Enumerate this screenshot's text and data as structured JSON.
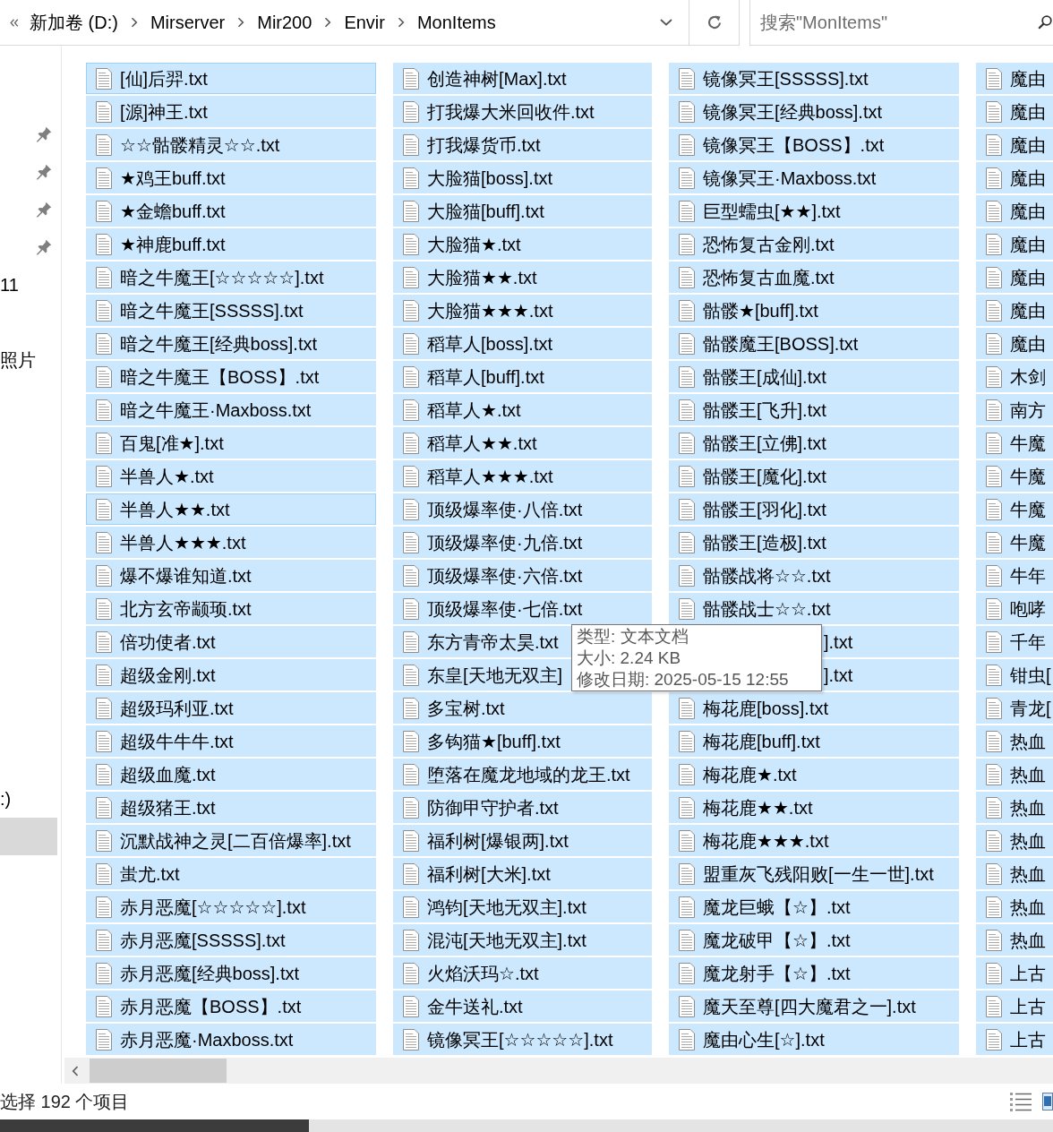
{
  "address_bar": {
    "path": [
      "新加卷 (D:)",
      "Mirserver",
      "Mir200",
      "Envir",
      "MonItems"
    ]
  },
  "search": {
    "placeholder": "搜索\"MonItems\""
  },
  "nav_pane": {
    "groups": [
      [
        {
          "pinned": true,
          "selected": false
        },
        {
          "pinned": true,
          "selected": false
        },
        {
          "pinned": true,
          "selected": false
        },
        {
          "pinned": true,
          "selected": false
        },
        {
          "label": "11",
          "pinned": false,
          "selected": false
        }
      ],
      [
        {
          "label": "照片",
          "pinned": false,
          "selected": false
        }
      ],
      [
        {
          "label": ":)",
          "pinned": false,
          "selected": false
        },
        {
          "pinned": false,
          "selected": true
        }
      ]
    ]
  },
  "file_list": {
    "columns": [
      {
        "items": [
          {
            "name": "[仙]后羿.txt",
            "kind": "file",
            "selected": true,
            "highlighted": true
          },
          {
            "name": "[源]神王.txt",
            "kind": "file",
            "selected": true,
            "highlighted": false
          },
          {
            "name": "☆☆骷髅精灵☆☆.txt",
            "kind": "file",
            "selected": true,
            "highlighted": false
          },
          {
            "name": "★鸡王buff.txt",
            "kind": "file",
            "selected": true,
            "highlighted": false
          },
          {
            "name": "★金蟾buff.txt",
            "kind": "file",
            "selected": true,
            "highlighted": false
          },
          {
            "name": "★神鹿buff.txt",
            "kind": "file",
            "selected": true,
            "highlighted": false
          },
          {
            "name": "暗之牛魔王[☆☆☆☆☆].txt",
            "kind": "file",
            "selected": true,
            "highlighted": false
          },
          {
            "name": "暗之牛魔王[SSSSS].txt",
            "kind": "file",
            "selected": true,
            "highlighted": false
          },
          {
            "name": "暗之牛魔王[经典boss].txt",
            "kind": "file",
            "selected": true,
            "highlighted": false
          },
          {
            "name": "暗之牛魔王【BOSS】.txt",
            "kind": "file",
            "selected": true,
            "highlighted": false
          },
          {
            "name": "暗之牛魔王·Maxboss.txt",
            "kind": "file",
            "selected": true,
            "highlighted": false
          },
          {
            "name": "百鬼[准★].txt",
            "kind": "file",
            "selected": true,
            "highlighted": false
          },
          {
            "name": "半兽人★.txt",
            "kind": "file",
            "selected": true,
            "highlighted": false
          },
          {
            "name": "半兽人★★.txt",
            "kind": "file",
            "selected": true,
            "highlighted": true
          },
          {
            "name": "半兽人★★★.txt",
            "kind": "file",
            "selected": true,
            "highlighted": false
          },
          {
            "name": "爆不爆谁知道.txt",
            "kind": "file",
            "selected": true,
            "highlighted": false
          },
          {
            "name": "北方玄帝颛顼.txt",
            "kind": "file",
            "selected": true,
            "highlighted": false
          },
          {
            "name": "倍功使者.txt",
            "kind": "file",
            "selected": true,
            "highlighted": false
          },
          {
            "name": "超级金刚.txt",
            "kind": "file",
            "selected": true,
            "highlighted": false
          },
          {
            "name": "超级玛利亚.txt",
            "kind": "file",
            "selected": true,
            "highlighted": false
          },
          {
            "name": "超级牛牛牛.txt",
            "kind": "file",
            "selected": true,
            "highlighted": false
          },
          {
            "name": "超级血魔.txt",
            "kind": "file",
            "selected": true,
            "highlighted": false
          },
          {
            "name": "超级猪王.txt",
            "kind": "file",
            "selected": true,
            "highlighted": false
          },
          {
            "name": "沉默战神之灵[二百倍爆率].txt",
            "kind": "file",
            "selected": true,
            "highlighted": false
          },
          {
            "name": "蚩尤.txt",
            "kind": "file",
            "selected": true,
            "highlighted": false
          },
          {
            "name": "赤月恶魔[☆☆☆☆☆].txt",
            "kind": "file",
            "selected": true,
            "highlighted": false
          },
          {
            "name": "赤月恶魔[SSSSS].txt",
            "kind": "file",
            "selected": true,
            "highlighted": false
          },
          {
            "name": "赤月恶魔[经典boss].txt",
            "kind": "file",
            "selected": true,
            "highlighted": false
          },
          {
            "name": "赤月恶魔【BOSS】.txt",
            "kind": "file",
            "selected": true,
            "highlighted": false
          },
          {
            "name": "赤月恶魔·Maxboss.txt",
            "kind": "file",
            "selected": true,
            "highlighted": false
          }
        ]
      },
      {
        "items": [
          {
            "name": "创造神树[Max].txt",
            "kind": "file",
            "selected": true,
            "highlighted": false
          },
          {
            "name": "打我爆大米回收件.txt",
            "kind": "file",
            "selected": true,
            "highlighted": false
          },
          {
            "name": "打我爆货币.txt",
            "kind": "file",
            "selected": true,
            "highlighted": false
          },
          {
            "name": "大脸猫[boss].txt",
            "kind": "file",
            "selected": true,
            "highlighted": false
          },
          {
            "name": "大脸猫[buff].txt",
            "kind": "file",
            "selected": true,
            "highlighted": false
          },
          {
            "name": "大脸猫★.txt",
            "kind": "file",
            "selected": true,
            "highlighted": false
          },
          {
            "name": "大脸猫★★.txt",
            "kind": "file",
            "selected": true,
            "highlighted": false
          },
          {
            "name": "大脸猫★★★.txt",
            "kind": "file",
            "selected": true,
            "highlighted": false
          },
          {
            "name": "稻草人[boss].txt",
            "kind": "file",
            "selected": true,
            "highlighted": false
          },
          {
            "name": "稻草人[buff].txt",
            "kind": "file",
            "selected": true,
            "highlighted": false
          },
          {
            "name": "稻草人★.txt",
            "kind": "file",
            "selected": true,
            "highlighted": false
          },
          {
            "name": "稻草人★★.txt",
            "kind": "file",
            "selected": true,
            "highlighted": false
          },
          {
            "name": "稻草人★★★.txt",
            "kind": "file",
            "selected": true,
            "highlighted": false
          },
          {
            "name": "顶级爆率使·八倍.txt",
            "kind": "file",
            "selected": true,
            "highlighted": false
          },
          {
            "name": "顶级爆率使·九倍.txt",
            "kind": "file",
            "selected": true,
            "highlighted": false
          },
          {
            "name": "顶级爆率使·六倍.txt",
            "kind": "file",
            "selected": true,
            "highlighted": false
          },
          {
            "name": "顶级爆率使·七倍.txt",
            "kind": "file",
            "selected": true,
            "highlighted": false
          },
          {
            "name": "东方青帝太昊.txt",
            "kind": "file",
            "selected": true,
            "highlighted": false
          },
          {
            "name": "东皇[天地无双主]",
            "kind": "file",
            "selected": true,
            "highlighted": false
          },
          {
            "name": "多宝树.txt",
            "kind": "file",
            "selected": true,
            "highlighted": false
          },
          {
            "name": "多钩猫★[buff].txt",
            "kind": "file",
            "selected": true,
            "highlighted": false
          },
          {
            "name": "堕落在魔龙地域的龙王.txt",
            "kind": "file",
            "selected": true,
            "highlighted": false
          },
          {
            "name": "防御甲守护者.txt",
            "kind": "file",
            "selected": true,
            "highlighted": false
          },
          {
            "name": "福利树[爆银两].txt",
            "kind": "file",
            "selected": true,
            "highlighted": false
          },
          {
            "name": "福利树[大米].txt",
            "kind": "file",
            "selected": true,
            "highlighted": false
          },
          {
            "name": "鸿钧[天地无双主].txt",
            "kind": "file",
            "selected": true,
            "highlighted": false
          },
          {
            "name": "混沌[天地无双主].txt",
            "kind": "file",
            "selected": true,
            "highlighted": false
          },
          {
            "name": "火焰沃玛☆.txt",
            "kind": "file",
            "selected": true,
            "highlighted": false
          },
          {
            "name": "金牛送礼.txt",
            "kind": "file",
            "selected": true,
            "highlighted": false
          },
          {
            "name": "镜像冥王[☆☆☆☆☆].txt",
            "kind": "file",
            "selected": true,
            "highlighted": false
          }
        ]
      },
      {
        "items": [
          {
            "name": "镜像冥王[SSSSS].txt",
            "kind": "file",
            "selected": true,
            "highlighted": false
          },
          {
            "name": "镜像冥王[经典boss].txt",
            "kind": "file",
            "selected": true,
            "highlighted": false
          },
          {
            "name": "镜像冥王【BOSS】.txt",
            "kind": "file",
            "selected": true,
            "highlighted": false
          },
          {
            "name": "镜像冥王·Maxboss.txt",
            "kind": "file",
            "selected": true,
            "highlighted": false
          },
          {
            "name": "巨型蠕虫[★★].txt",
            "kind": "file",
            "selected": true,
            "highlighted": false
          },
          {
            "name": "恐怖复古金刚.txt",
            "kind": "file",
            "selected": true,
            "highlighted": false
          },
          {
            "name": "恐怖复古血魔.txt",
            "kind": "file",
            "selected": true,
            "highlighted": false
          },
          {
            "name": "骷髅★[buff].txt",
            "kind": "file",
            "selected": true,
            "highlighted": false
          },
          {
            "name": "骷髅魔王[BOSS].txt",
            "kind": "file",
            "selected": true,
            "highlighted": false
          },
          {
            "name": "骷髅王[成仙].txt",
            "kind": "file",
            "selected": true,
            "highlighted": false
          },
          {
            "name": "骷髅王[飞升].txt",
            "kind": "file",
            "selected": true,
            "highlighted": false
          },
          {
            "name": "骷髅王[立佛].txt",
            "kind": "file",
            "selected": true,
            "highlighted": false
          },
          {
            "name": "骷髅王[魔化].txt",
            "kind": "file",
            "selected": true,
            "highlighted": false
          },
          {
            "name": "骷髅王[羽化].txt",
            "kind": "file",
            "selected": true,
            "highlighted": false
          },
          {
            "name": "骷髅王[造极].txt",
            "kind": "file",
            "selected": true,
            "highlighted": false
          },
          {
            "name": "骷髅战将☆☆.txt",
            "kind": "file",
            "selected": true,
            "highlighted": false
          },
          {
            "name": "骷髅战士☆☆.txt",
            "kind": "file",
            "selected": true,
            "highlighted": false
          },
          {
            "name": "].txt",
            "kind": "covered",
            "selected": true,
            "highlighted": false
          },
          {
            "name": "].txt",
            "kind": "covered",
            "selected": true,
            "highlighted": false
          },
          {
            "name": "梅花鹿[boss].txt",
            "kind": "file",
            "selected": true,
            "highlighted": false
          },
          {
            "name": "梅花鹿[buff].txt",
            "kind": "file",
            "selected": true,
            "highlighted": false
          },
          {
            "name": "梅花鹿★.txt",
            "kind": "file",
            "selected": true,
            "highlighted": false
          },
          {
            "name": "梅花鹿★★.txt",
            "kind": "file",
            "selected": true,
            "highlighted": false
          },
          {
            "name": "梅花鹿★★★.txt",
            "kind": "file",
            "selected": true,
            "highlighted": false
          },
          {
            "name": "盟重灰飞残阳败[一生一世].txt",
            "kind": "file",
            "selected": true,
            "highlighted": false
          },
          {
            "name": "魔龙巨蛾【☆】.txt",
            "kind": "file",
            "selected": true,
            "highlighted": false
          },
          {
            "name": "魔龙破甲【☆】.txt",
            "kind": "file",
            "selected": true,
            "highlighted": false
          },
          {
            "name": "魔龙射手【☆】.txt",
            "kind": "file",
            "selected": true,
            "highlighted": false
          },
          {
            "name": "魔天至尊[四大魔君之一].txt",
            "kind": "file",
            "selected": true,
            "highlighted": false
          },
          {
            "name": "魔由心生[☆].txt",
            "kind": "file",
            "selected": true,
            "highlighted": false
          }
        ]
      },
      {
        "items": [
          {
            "name": "魔由",
            "kind": "file",
            "selected": true,
            "highlighted": false
          },
          {
            "name": "魔由",
            "kind": "file",
            "selected": true,
            "highlighted": false
          },
          {
            "name": "魔由",
            "kind": "file",
            "selected": true,
            "highlighted": false
          },
          {
            "name": "魔由",
            "kind": "file",
            "selected": true,
            "highlighted": false
          },
          {
            "name": "魔由",
            "kind": "file",
            "selected": true,
            "highlighted": false
          },
          {
            "name": "魔由",
            "kind": "file",
            "selected": true,
            "highlighted": false
          },
          {
            "name": "魔由",
            "kind": "file",
            "selected": true,
            "highlighted": false
          },
          {
            "name": "魔由",
            "kind": "file",
            "selected": true,
            "highlighted": false
          },
          {
            "name": "魔由",
            "kind": "file",
            "selected": true,
            "highlighted": false
          },
          {
            "name": "木剑",
            "kind": "file",
            "selected": true,
            "highlighted": false
          },
          {
            "name": "南方",
            "kind": "file",
            "selected": true,
            "highlighted": false
          },
          {
            "name": "牛魔",
            "kind": "file",
            "selected": true,
            "highlighted": false
          },
          {
            "name": "牛魔",
            "kind": "file",
            "selected": true,
            "highlighted": false
          },
          {
            "name": "牛魔",
            "kind": "file",
            "selected": true,
            "highlighted": false
          },
          {
            "name": "牛魔",
            "kind": "file",
            "selected": true,
            "highlighted": false
          },
          {
            "name": "牛年",
            "kind": "file",
            "selected": true,
            "highlighted": false
          },
          {
            "name": "咆哮",
            "kind": "file",
            "selected": true,
            "highlighted": false
          },
          {
            "name": "千年",
            "kind": "file",
            "selected": true,
            "highlighted": false
          },
          {
            "name": "钳虫[",
            "kind": "file",
            "selected": true,
            "highlighted": false
          },
          {
            "name": "青龙[",
            "kind": "file",
            "selected": true,
            "highlighted": false
          },
          {
            "name": "热血",
            "kind": "file",
            "selected": true,
            "highlighted": false
          },
          {
            "name": "热血",
            "kind": "file",
            "selected": true,
            "highlighted": false
          },
          {
            "name": "热血",
            "kind": "file",
            "selected": true,
            "highlighted": false
          },
          {
            "name": "热血",
            "kind": "file",
            "selected": true,
            "highlighted": false
          },
          {
            "name": "热血",
            "kind": "file",
            "selected": true,
            "highlighted": false
          },
          {
            "name": "热血",
            "kind": "file",
            "selected": true,
            "highlighted": false
          },
          {
            "name": "热血",
            "kind": "file",
            "selected": true,
            "highlighted": false
          },
          {
            "name": "上古",
            "kind": "file",
            "selected": true,
            "highlighted": false
          },
          {
            "name": "上古",
            "kind": "file",
            "selected": true,
            "highlighted": false
          },
          {
            "name": "上古",
            "kind": "file",
            "selected": true,
            "highlighted": false
          }
        ]
      }
    ]
  },
  "tooltip": {
    "lines": [
      "类型: 文本文档",
      "大小: 2.24 KB",
      "修改日期: 2025-05-15 12:55"
    ]
  },
  "status_bar": {
    "selection_text": "选择 192 个项目"
  }
}
